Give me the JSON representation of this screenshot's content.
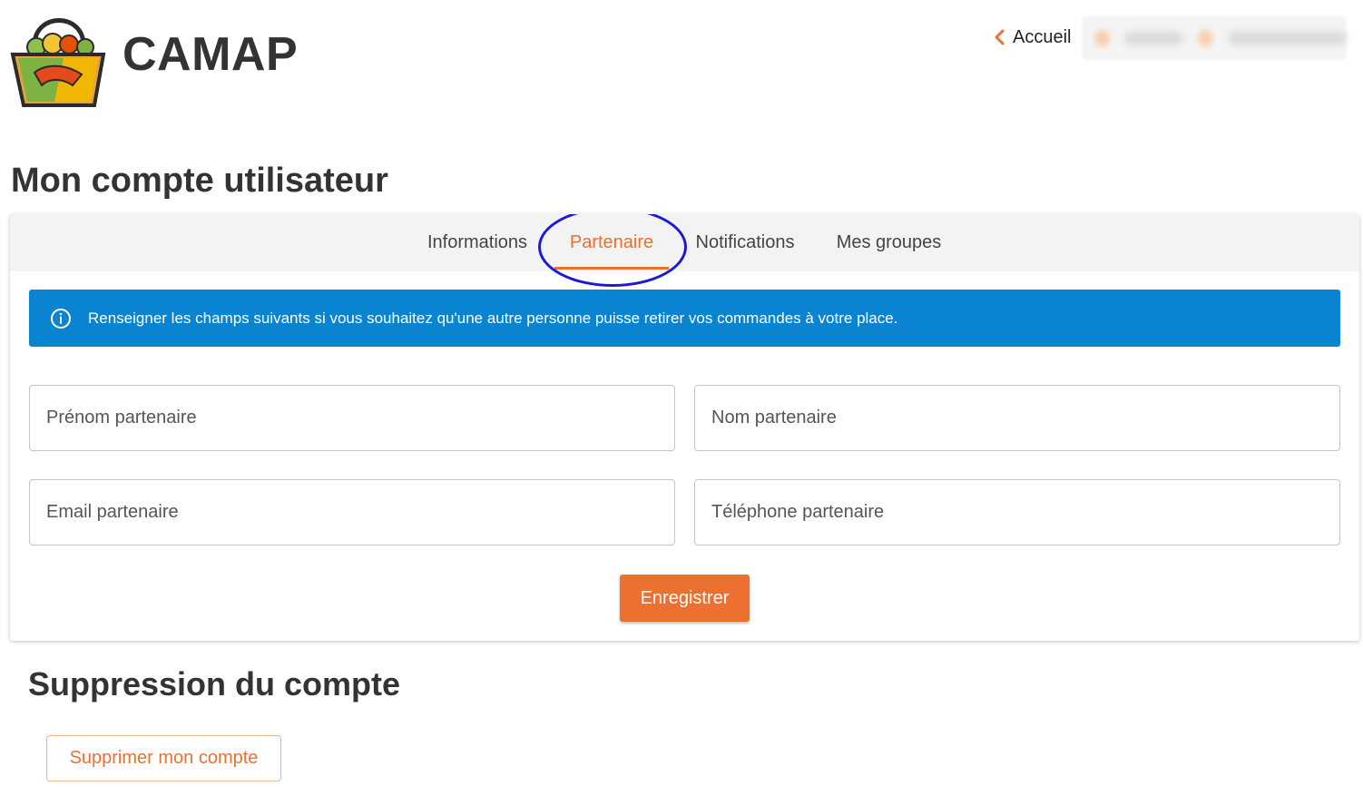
{
  "header": {
    "brand": "CAMAP",
    "home_label": "Accueil"
  },
  "page": {
    "title": "Mon compte utilisateur"
  },
  "tabs": [
    {
      "label": "Informations",
      "active": false
    },
    {
      "label": "Partenaire",
      "active": true
    },
    {
      "label": "Notifications",
      "active": false
    },
    {
      "label": "Mes groupes",
      "active": false
    }
  ],
  "alert": {
    "icon": "info-icon",
    "text": "Renseigner les champs suivants si vous souhaitez qu'une autre personne puisse retirer vos commandes à votre place."
  },
  "form": {
    "first_name": {
      "placeholder": "Prénom partenaire",
      "value": ""
    },
    "last_name": {
      "placeholder": "Nom partenaire",
      "value": ""
    },
    "email": {
      "placeholder": "Email partenaire",
      "value": ""
    },
    "phone": {
      "placeholder": "Téléphone partenaire",
      "value": ""
    },
    "save_label": "Enregistrer"
  },
  "deletion": {
    "title": "Suppression du compte",
    "button_label": "Supprimer mon compte"
  },
  "colors": {
    "accent": "#ec7030",
    "info": "#0a84d0",
    "annotation": "#1a1ad6"
  }
}
